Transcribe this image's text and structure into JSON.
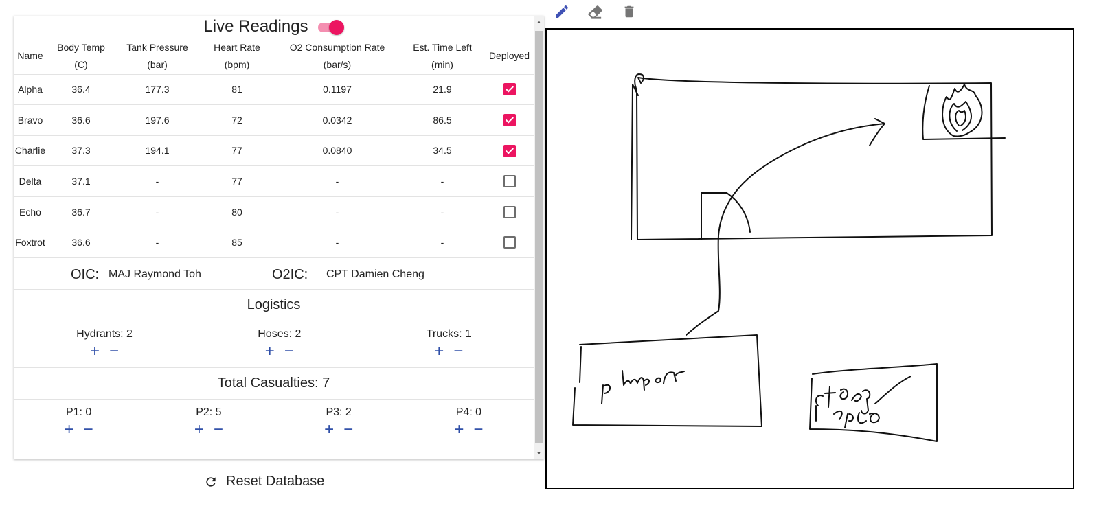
{
  "live_readings": {
    "title": "Live Readings",
    "toggle_on": true,
    "columns": [
      {
        "line1": "Name",
        "line2": ""
      },
      {
        "line1": "Body Temp",
        "line2": "(C)"
      },
      {
        "line1": "Tank Pressure",
        "line2": "(bar)"
      },
      {
        "line1": "Heart Rate",
        "line2": "(bpm)"
      },
      {
        "line1": "O2 Consumption Rate",
        "line2": "(bar/s)"
      },
      {
        "line1": "Est. Time Left",
        "line2": "(min)"
      },
      {
        "line1": "Deployed",
        "line2": ""
      }
    ],
    "rows": [
      {
        "name": "Alpha",
        "body_temp": "36.4",
        "tank_pressure": "177.3",
        "heart_rate": "81",
        "o2_rate": "0.1197",
        "time_left": "21.9",
        "deployed": true
      },
      {
        "name": "Bravo",
        "body_temp": "36.6",
        "tank_pressure": "197.6",
        "heart_rate": "72",
        "o2_rate": "0.0342",
        "time_left": "86.5",
        "deployed": true
      },
      {
        "name": "Charlie",
        "body_temp": "37.3",
        "tank_pressure": "194.1",
        "heart_rate": "77",
        "o2_rate": "0.0840",
        "time_left": "34.5",
        "deployed": true
      },
      {
        "name": "Delta",
        "body_temp": "37.1",
        "tank_pressure": "-",
        "heart_rate": "77",
        "o2_rate": "-",
        "time_left": "-",
        "deployed": false
      },
      {
        "name": "Echo",
        "body_temp": "36.7",
        "tank_pressure": "-",
        "heart_rate": "80",
        "o2_rate": "-",
        "time_left": "-",
        "deployed": false
      },
      {
        "name": "Foxtrot",
        "body_temp": "36.6",
        "tank_pressure": "-",
        "heart_rate": "85",
        "o2_rate": "-",
        "time_left": "-",
        "deployed": false
      }
    ]
  },
  "officers": {
    "oic_label": "OIC:",
    "oic_value": "MAJ Raymond Toh",
    "o2ic_label": "O2IC:",
    "o2ic_value": "CPT Damien Cheng"
  },
  "logistics": {
    "title": "Logistics",
    "items": [
      {
        "label": "Hydrants: 2"
      },
      {
        "label": "Hoses: 2"
      },
      {
        "label": "Trucks: 1"
      }
    ]
  },
  "casualties": {
    "title": "Total Casualties: 7",
    "items": [
      {
        "label": "P1: 0"
      },
      {
        "label": "P2: 5"
      },
      {
        "label": "P3: 2"
      },
      {
        "label": "P4: 0"
      }
    ]
  },
  "controls": {
    "plus": "+",
    "minus": "−",
    "reset_label": "Reset Database"
  },
  "canvas": {
    "handwritten_texts": [
      "pumper",
      "staging area"
    ]
  },
  "colors": {
    "accent_pink": "#ec1561",
    "toolbar_blue": "#2f4fa8",
    "pen_icon": "#3f51b5"
  }
}
